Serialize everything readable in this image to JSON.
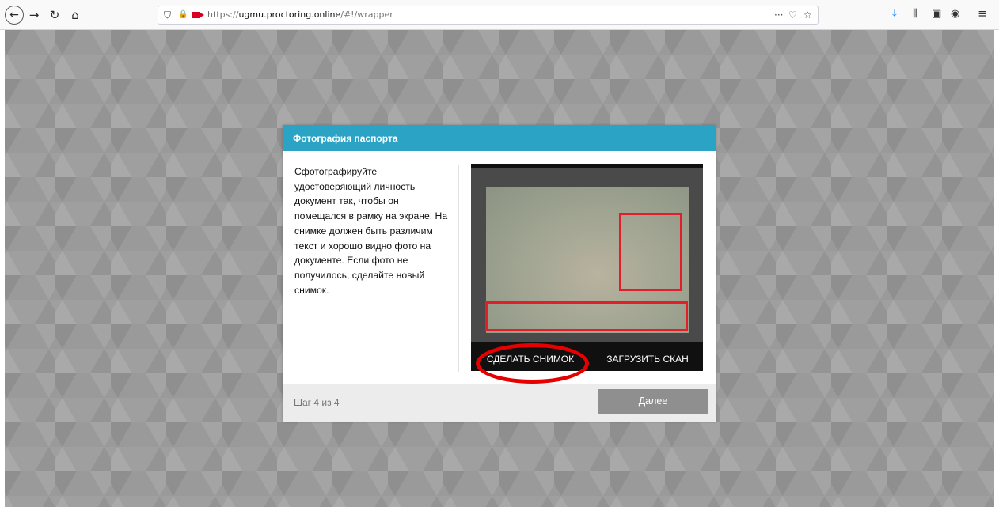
{
  "browser": {
    "url_scheme": "https://",
    "url_host": "ugmu.proctoring.online",
    "url_path": "/#!/wrapper",
    "icons": {
      "back": "back-arrow-icon",
      "forward": "forward-arrow-icon",
      "reload": "reload-icon",
      "home": "home-icon",
      "shield": "tracking-protection-icon",
      "lock": "lock-icon",
      "camera": "camera-sharing-icon",
      "more": "more-actions-icon",
      "pocket": "pocket-icon",
      "bookmark": "bookmark-star-icon",
      "downloads": "downloads-icon",
      "library": "library-icon",
      "sidebar": "sidebar-icon",
      "account": "account-icon",
      "menu": "hamburger-menu-icon"
    },
    "glyphs": {
      "back": "←",
      "forward": "→",
      "reload": "↻",
      "home": "⌂",
      "shield": "⛉",
      "lock": "🔒",
      "more": "···",
      "pocket": "♡",
      "bookmark": "☆",
      "downloads": "⤓",
      "library": "⫼",
      "sidebar": "▣",
      "account": "◉",
      "menu": "≡"
    }
  },
  "modal": {
    "title": "Фотография паспорта",
    "instructions": "Сфотографируйте удостоверяющий личность документ так, чтобы он помещался в рамку на экране. На снимке должен быть различим текст и хорошо видно фото на документе. Если фото не получилось, сделайте новый снимок.",
    "take_photo_label": "СДЕЛАТЬ СНИМОК",
    "upload_scan_label": "ЗАГРУЗИТЬ СКАН",
    "step_text": "Шаг 4 из 4",
    "next_label": "Далее"
  },
  "colors": {
    "header": "#2ba3c4",
    "frame": "#e21e28",
    "highlight_ring": "#e60000",
    "next_button": "#8f8f8f"
  }
}
